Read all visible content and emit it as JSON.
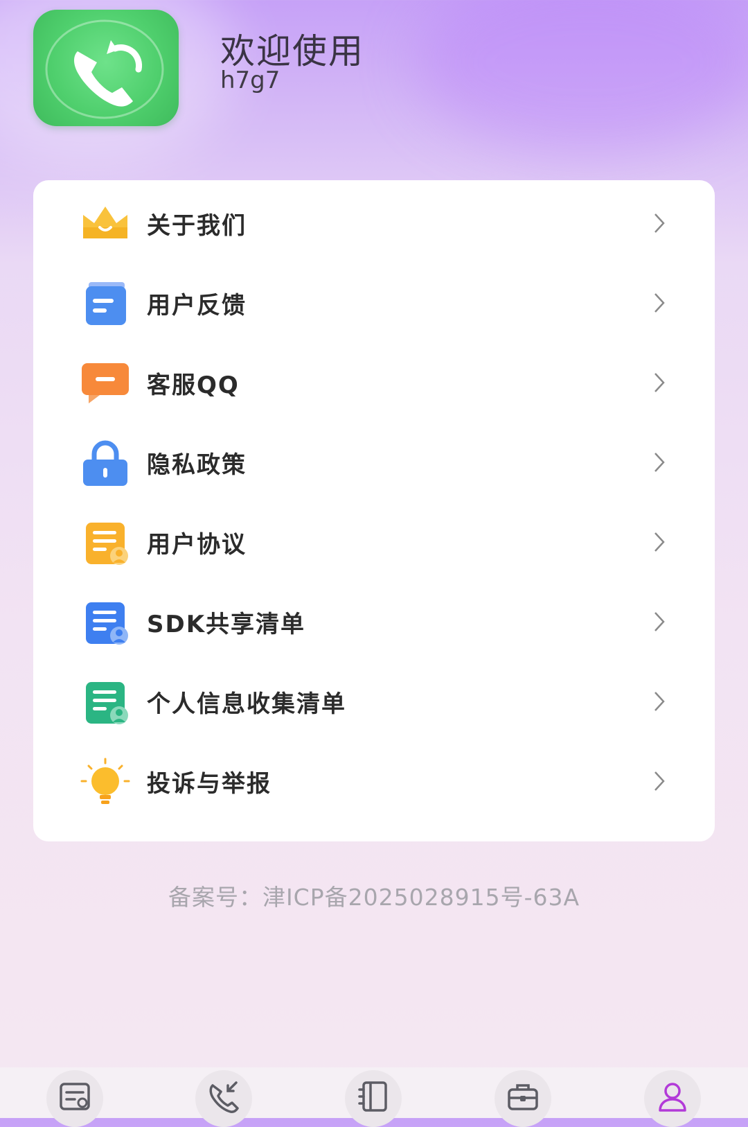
{
  "header": {
    "welcome": "欢迎使用",
    "username": "h7g7"
  },
  "menu": {
    "items": [
      {
        "label": "关于我们",
        "icon": "crown-icon"
      },
      {
        "label": "用户反馈",
        "icon": "feedback-note-icon"
      },
      {
        "label": "客服QQ",
        "icon": "chat-bubble-icon"
      },
      {
        "label": "隐私政策",
        "icon": "lock-icon"
      },
      {
        "label": "用户协议",
        "icon": "agreement-document-icon"
      },
      {
        "label": "SDK共享清单",
        "icon": "sdk-list-icon"
      },
      {
        "label": "个人信息收集清单",
        "icon": "personal-info-list-icon"
      },
      {
        "label": "投诉与举报",
        "icon": "lightbulb-icon"
      }
    ]
  },
  "footer": {
    "record": "备案号：津ICP备2025028915号-63A"
  },
  "tabbar": {
    "tabs": [
      {
        "icon": "records-icon",
        "active": false
      },
      {
        "icon": "incoming-call-icon",
        "active": false
      },
      {
        "icon": "contacts-book-icon",
        "active": false
      },
      {
        "icon": "toolbox-icon",
        "active": false
      },
      {
        "icon": "profile-icon",
        "active": true
      }
    ]
  },
  "colors": {
    "accent": "#b23ad8",
    "logo_green": "#4fcf6d",
    "tab_icon": "#5c5c64"
  }
}
